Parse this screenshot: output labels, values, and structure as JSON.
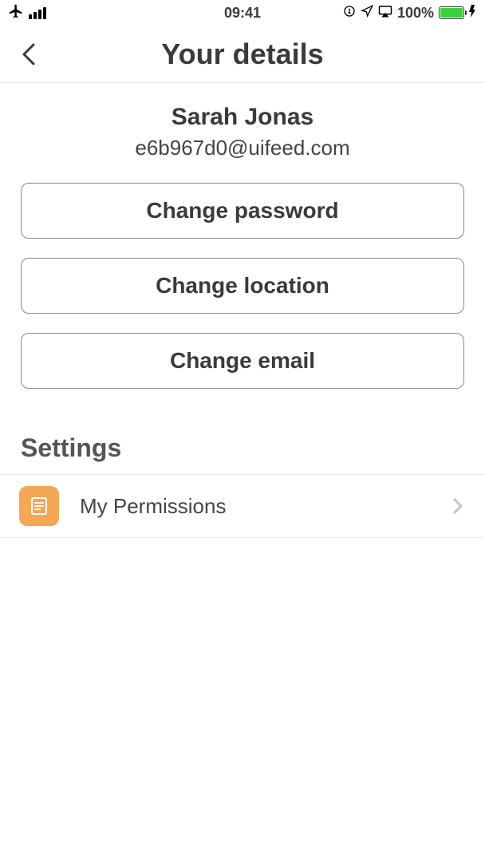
{
  "status": {
    "time": "09:41",
    "battery": "100%"
  },
  "header": {
    "title": "Your details"
  },
  "user": {
    "name": "Sarah Jonas",
    "email": "e6b967d0@uifeed.com"
  },
  "buttons": {
    "change_password": "Change password",
    "change_location": "Change location",
    "change_email": "Change email"
  },
  "sections": {
    "settings_label": "Settings"
  },
  "settings": {
    "permissions_label": "My Permissions"
  }
}
